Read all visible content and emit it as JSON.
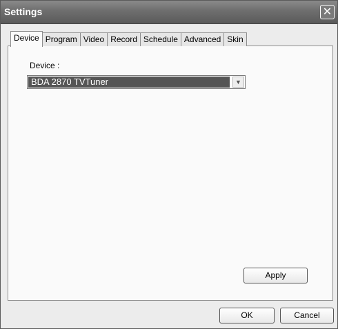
{
  "window": {
    "title": "Settings",
    "close_glyph": "✕"
  },
  "tabs": [
    {
      "label": "Device",
      "active": true
    },
    {
      "label": "Program"
    },
    {
      "label": "Video"
    },
    {
      "label": "Record"
    },
    {
      "label": "Schedule"
    },
    {
      "label": "Advanced"
    },
    {
      "label": "Skin"
    }
  ],
  "device": {
    "label": "Device :",
    "selected": "BDA 2870 TVTuner",
    "arrow_glyph": "▼"
  },
  "buttons": {
    "apply": "Apply",
    "ok": "OK",
    "cancel": "Cancel"
  },
  "colors": {
    "titlebar": "#6e6e6e",
    "selection": "#555555",
    "dialog_bg": "#ececec"
  }
}
